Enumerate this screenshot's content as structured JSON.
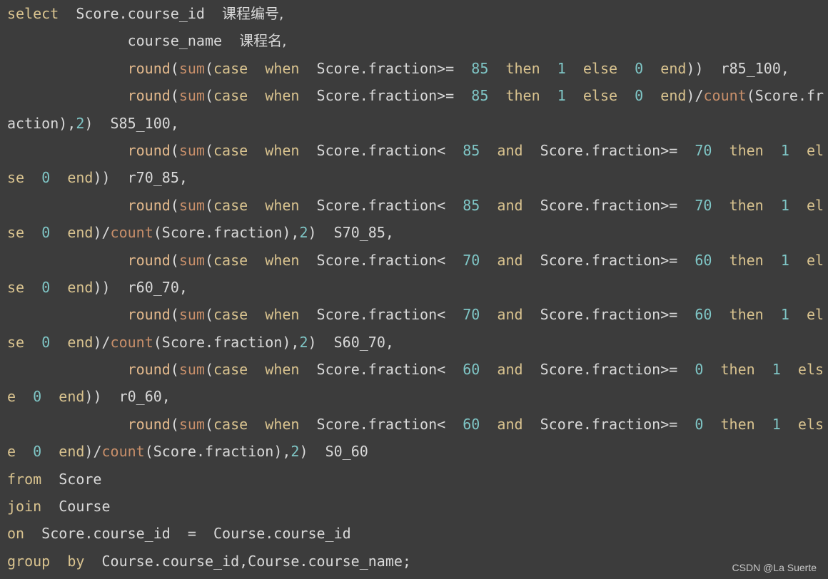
{
  "colors": {
    "background": "#3c3c3c",
    "keyword": "#d9c38f",
    "function": "#e3b98c",
    "aggregate": "#c88f6a",
    "number": "#7fc6c6",
    "plain": "#d9d9d9"
  },
  "lines": [
    [
      [
        "kw",
        "select"
      ],
      [
        "pl",
        "  Score.course_id  "
      ],
      [
        "cn",
        "课程编号,"
      ]
    ],
    [
      [
        "pl",
        "              course_name  "
      ],
      [
        "cn",
        "课程名,"
      ]
    ],
    [
      [
        "pl",
        "              "
      ],
      [
        "fn",
        "round"
      ],
      [
        "pl",
        "("
      ],
      [
        "agg",
        "sum"
      ],
      [
        "pl",
        "("
      ],
      [
        "kw",
        "case"
      ],
      [
        "pl",
        "  "
      ],
      [
        "kw",
        "when"
      ],
      [
        "pl",
        "  Score.fraction>=  "
      ],
      [
        "num",
        "85"
      ],
      [
        "pl",
        "  "
      ],
      [
        "kw",
        "then"
      ],
      [
        "pl",
        "  "
      ],
      [
        "num",
        "1"
      ],
      [
        "pl",
        "  "
      ],
      [
        "kw",
        "else"
      ],
      [
        "pl",
        "  "
      ],
      [
        "num",
        "0"
      ],
      [
        "pl",
        "  "
      ],
      [
        "kw",
        "end"
      ],
      [
        "pl",
        "))  r85_100,"
      ]
    ],
    [
      [
        "pl",
        "              "
      ],
      [
        "fn",
        "round"
      ],
      [
        "pl",
        "("
      ],
      [
        "agg",
        "sum"
      ],
      [
        "pl",
        "("
      ],
      [
        "kw",
        "case"
      ],
      [
        "pl",
        "  "
      ],
      [
        "kw",
        "when"
      ],
      [
        "pl",
        "  Score.fraction>=  "
      ],
      [
        "num",
        "85"
      ],
      [
        "pl",
        "  "
      ],
      [
        "kw",
        "then"
      ],
      [
        "pl",
        "  "
      ],
      [
        "num",
        "1"
      ],
      [
        "pl",
        "  "
      ],
      [
        "kw",
        "else"
      ],
      [
        "pl",
        "  "
      ],
      [
        "num",
        "0"
      ],
      [
        "pl",
        "  "
      ],
      [
        "kw",
        "end"
      ],
      [
        "pl",
        ")/"
      ],
      [
        "agg",
        "count"
      ],
      [
        "pl",
        "(Score.fr"
      ]
    ],
    [
      [
        "pl",
        "action),"
      ],
      [
        "num",
        "2"
      ],
      [
        "pl",
        ")  S85_100,"
      ]
    ],
    [
      [
        "pl",
        "              "
      ],
      [
        "fn",
        "round"
      ],
      [
        "pl",
        "("
      ],
      [
        "agg",
        "sum"
      ],
      [
        "pl",
        "("
      ],
      [
        "kw",
        "case"
      ],
      [
        "pl",
        "  "
      ],
      [
        "kw",
        "when"
      ],
      [
        "pl",
        "  Score.fraction<  "
      ],
      [
        "num",
        "85"
      ],
      [
        "pl",
        "  "
      ],
      [
        "kw",
        "and"
      ],
      [
        "pl",
        "  Score.fraction>=  "
      ],
      [
        "num",
        "70"
      ],
      [
        "pl",
        "  "
      ],
      [
        "kw",
        "then"
      ],
      [
        "pl",
        "  "
      ],
      [
        "num",
        "1"
      ],
      [
        "pl",
        "  "
      ],
      [
        "kw",
        "el"
      ]
    ],
    [
      [
        "kw",
        "se"
      ],
      [
        "pl",
        "  "
      ],
      [
        "num",
        "0"
      ],
      [
        "pl",
        "  "
      ],
      [
        "kw",
        "end"
      ],
      [
        "pl",
        "))  r70_85,"
      ]
    ],
    [
      [
        "pl",
        "              "
      ],
      [
        "fn",
        "round"
      ],
      [
        "pl",
        "("
      ],
      [
        "agg",
        "sum"
      ],
      [
        "pl",
        "("
      ],
      [
        "kw",
        "case"
      ],
      [
        "pl",
        "  "
      ],
      [
        "kw",
        "when"
      ],
      [
        "pl",
        "  Score.fraction<  "
      ],
      [
        "num",
        "85"
      ],
      [
        "pl",
        "  "
      ],
      [
        "kw",
        "and"
      ],
      [
        "pl",
        "  Score.fraction>=  "
      ],
      [
        "num",
        "70"
      ],
      [
        "pl",
        "  "
      ],
      [
        "kw",
        "then"
      ],
      [
        "pl",
        "  "
      ],
      [
        "num",
        "1"
      ],
      [
        "pl",
        "  "
      ],
      [
        "kw",
        "el"
      ]
    ],
    [
      [
        "kw",
        "se"
      ],
      [
        "pl",
        "  "
      ],
      [
        "num",
        "0"
      ],
      [
        "pl",
        "  "
      ],
      [
        "kw",
        "end"
      ],
      [
        "pl",
        ")/"
      ],
      [
        "agg",
        "count"
      ],
      [
        "pl",
        "(Score.fraction),"
      ],
      [
        "num",
        "2"
      ],
      [
        "pl",
        ")  S70_85,"
      ]
    ],
    [
      [
        "pl",
        "              "
      ],
      [
        "fn",
        "round"
      ],
      [
        "pl",
        "("
      ],
      [
        "agg",
        "sum"
      ],
      [
        "pl",
        "("
      ],
      [
        "kw",
        "case"
      ],
      [
        "pl",
        "  "
      ],
      [
        "kw",
        "when"
      ],
      [
        "pl",
        "  Score.fraction<  "
      ],
      [
        "num",
        "70"
      ],
      [
        "pl",
        "  "
      ],
      [
        "kw",
        "and"
      ],
      [
        "pl",
        "  Score.fraction>=  "
      ],
      [
        "num",
        "60"
      ],
      [
        "pl",
        "  "
      ],
      [
        "kw",
        "then"
      ],
      [
        "pl",
        "  "
      ],
      [
        "num",
        "1"
      ],
      [
        "pl",
        "  "
      ],
      [
        "kw",
        "el"
      ]
    ],
    [
      [
        "kw",
        "se"
      ],
      [
        "pl",
        "  "
      ],
      [
        "num",
        "0"
      ],
      [
        "pl",
        "  "
      ],
      [
        "kw",
        "end"
      ],
      [
        "pl",
        "))  r60_70,"
      ]
    ],
    [
      [
        "pl",
        "              "
      ],
      [
        "fn",
        "round"
      ],
      [
        "pl",
        "("
      ],
      [
        "agg",
        "sum"
      ],
      [
        "pl",
        "("
      ],
      [
        "kw",
        "case"
      ],
      [
        "pl",
        "  "
      ],
      [
        "kw",
        "when"
      ],
      [
        "pl",
        "  Score.fraction<  "
      ],
      [
        "num",
        "70"
      ],
      [
        "pl",
        "  "
      ],
      [
        "kw",
        "and"
      ],
      [
        "pl",
        "  Score.fraction>=  "
      ],
      [
        "num",
        "60"
      ],
      [
        "pl",
        "  "
      ],
      [
        "kw",
        "then"
      ],
      [
        "pl",
        "  "
      ],
      [
        "num",
        "1"
      ],
      [
        "pl",
        "  "
      ],
      [
        "kw",
        "el"
      ]
    ],
    [
      [
        "kw",
        "se"
      ],
      [
        "pl",
        "  "
      ],
      [
        "num",
        "0"
      ],
      [
        "pl",
        "  "
      ],
      [
        "kw",
        "end"
      ],
      [
        "pl",
        ")/"
      ],
      [
        "agg",
        "count"
      ],
      [
        "pl",
        "(Score.fraction),"
      ],
      [
        "num",
        "2"
      ],
      [
        "pl",
        ")  S60_70,"
      ]
    ],
    [
      [
        "pl",
        "              "
      ],
      [
        "fn",
        "round"
      ],
      [
        "pl",
        "("
      ],
      [
        "agg",
        "sum"
      ],
      [
        "pl",
        "("
      ],
      [
        "kw",
        "case"
      ],
      [
        "pl",
        "  "
      ],
      [
        "kw",
        "when"
      ],
      [
        "pl",
        "  Score.fraction<  "
      ],
      [
        "num",
        "60"
      ],
      [
        "pl",
        "  "
      ],
      [
        "kw",
        "and"
      ],
      [
        "pl",
        "  Score.fraction>=  "
      ],
      [
        "num",
        "0"
      ],
      [
        "pl",
        "  "
      ],
      [
        "kw",
        "then"
      ],
      [
        "pl",
        "  "
      ],
      [
        "num",
        "1"
      ],
      [
        "pl",
        "  "
      ],
      [
        "kw",
        "els"
      ]
    ],
    [
      [
        "kw",
        "e"
      ],
      [
        "pl",
        "  "
      ],
      [
        "num",
        "0"
      ],
      [
        "pl",
        "  "
      ],
      [
        "kw",
        "end"
      ],
      [
        "pl",
        "))  r0_60,"
      ]
    ],
    [
      [
        "pl",
        "              "
      ],
      [
        "fn",
        "round"
      ],
      [
        "pl",
        "("
      ],
      [
        "agg",
        "sum"
      ],
      [
        "pl",
        "("
      ],
      [
        "kw",
        "case"
      ],
      [
        "pl",
        "  "
      ],
      [
        "kw",
        "when"
      ],
      [
        "pl",
        "  Score.fraction<  "
      ],
      [
        "num",
        "60"
      ],
      [
        "pl",
        "  "
      ],
      [
        "kw",
        "and"
      ],
      [
        "pl",
        "  Score.fraction>=  "
      ],
      [
        "num",
        "0"
      ],
      [
        "pl",
        "  "
      ],
      [
        "kw",
        "then"
      ],
      [
        "pl",
        "  "
      ],
      [
        "num",
        "1"
      ],
      [
        "pl",
        "  "
      ],
      [
        "kw",
        "els"
      ]
    ],
    [
      [
        "kw",
        "e"
      ],
      [
        "pl",
        "  "
      ],
      [
        "num",
        "0"
      ],
      [
        "pl",
        "  "
      ],
      [
        "kw",
        "end"
      ],
      [
        "pl",
        ")/"
      ],
      [
        "agg",
        "count"
      ],
      [
        "pl",
        "(Score.fraction),"
      ],
      [
        "num",
        "2"
      ],
      [
        "pl",
        ")  S0_60"
      ]
    ],
    [
      [
        "kw",
        "from"
      ],
      [
        "pl",
        "  Score"
      ]
    ],
    [
      [
        "kw",
        "join"
      ],
      [
        "pl",
        "  Course"
      ]
    ],
    [
      [
        "kw",
        "on"
      ],
      [
        "pl",
        "  Score.course_id  =  Course.course_id"
      ]
    ],
    [
      [
        "kw",
        "group"
      ],
      [
        "pl",
        "  "
      ],
      [
        "kw",
        "by"
      ],
      [
        "pl",
        "  Course.course_id,Course.course_name;"
      ]
    ]
  ],
  "watermark": "CSDN @La Suerte"
}
